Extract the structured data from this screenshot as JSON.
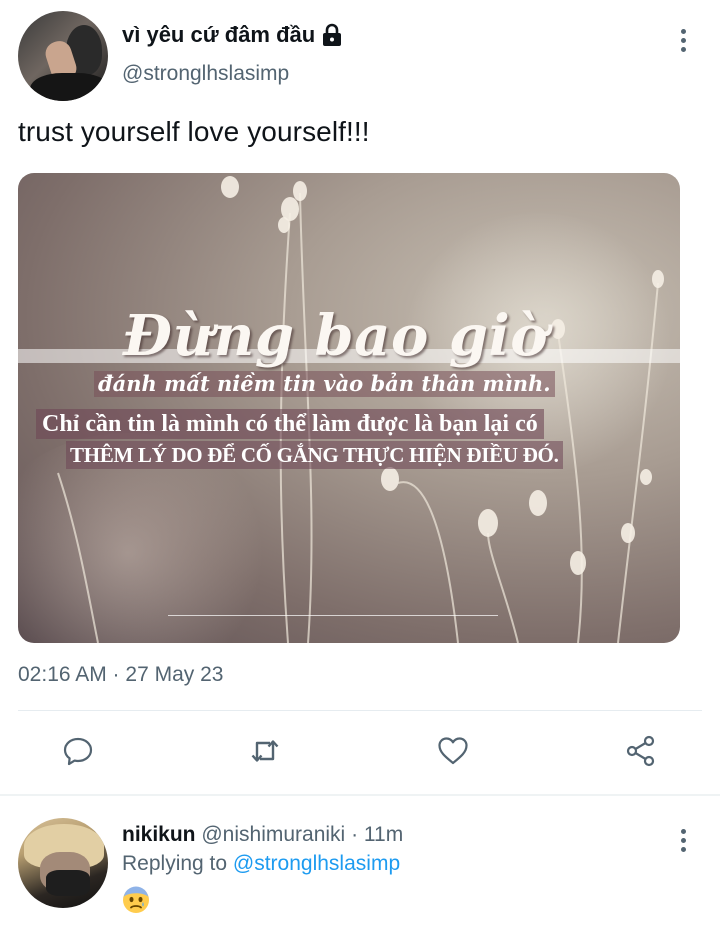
{
  "tweet": {
    "display_name": "vì yêu cứ đâm đầu",
    "handle": "@stronglhslasimp",
    "text": "trust yourself love yourself!!!",
    "image_text": {
      "headline": "Đừng bao giờ",
      "line1": "đánh mất niềm tin vào bản thân mình.",
      "line2": "Chỉ cần tin là mình có thể làm được là bạn lại có",
      "line3": "THÊM LÝ DO ĐỂ CỐ GẮNG THỰC HIỆN ĐIỀU ĐÓ."
    },
    "timestamp": "02:16 AM · 27 May 23",
    "icons": {
      "lock": "lock-icon",
      "more": "more-vertical-icon",
      "reply": "comment-icon",
      "retweet": "retweet-icon",
      "like": "heart-icon",
      "share": "share-icon"
    }
  },
  "reply": {
    "name": "nikikun",
    "handle": "@nishimuraniki",
    "dot": "·",
    "time": "11m",
    "replying_prefix": "Replying to",
    "replying_to": "@stronglhslasimp",
    "emoji_icon": "anxious-face-emoji"
  },
  "colors": {
    "text_primary": "#0f1419",
    "text_secondary": "#536471",
    "link": "#1d9bf0",
    "divider": "#eff3f4"
  }
}
